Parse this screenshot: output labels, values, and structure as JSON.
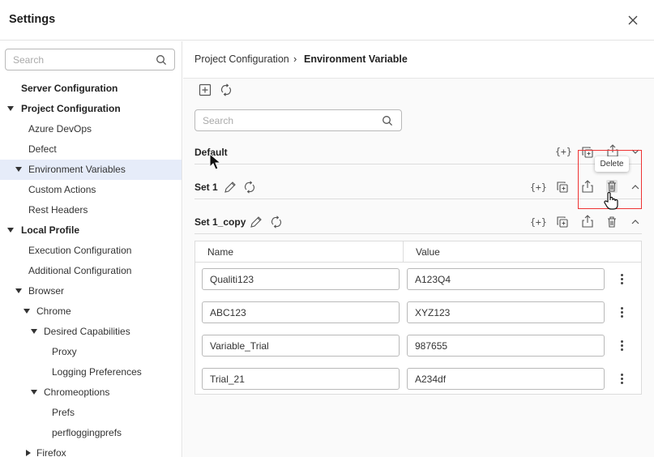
{
  "window": {
    "title": "Settings"
  },
  "sidebar": {
    "search_placeholder": "Search",
    "items": [
      {
        "label": "Server Configuration",
        "bold": true,
        "level": 0,
        "caret": "none"
      },
      {
        "label": "Project Configuration",
        "bold": true,
        "level": 0,
        "caret": "down"
      },
      {
        "label": "Azure DevOps",
        "bold": false,
        "level": 1,
        "caret": "none"
      },
      {
        "label": "Defect",
        "bold": false,
        "level": 1,
        "caret": "none"
      },
      {
        "label": "Environment Variables",
        "bold": false,
        "level": 1,
        "caret": "down",
        "selected": true
      },
      {
        "label": "Custom Actions",
        "bold": false,
        "level": 1,
        "caret": "none"
      },
      {
        "label": "Rest Headers",
        "bold": false,
        "level": 1,
        "caret": "none"
      },
      {
        "label": "Local Profile",
        "bold": true,
        "level": 0,
        "caret": "down"
      },
      {
        "label": "Execution Configuration",
        "bold": false,
        "level": 1,
        "caret": "none"
      },
      {
        "label": "Additional Configuration",
        "bold": false,
        "level": 1,
        "caret": "none"
      },
      {
        "label": "Browser",
        "bold": false,
        "level": 1,
        "caret": "down"
      },
      {
        "label": "Chrome",
        "bold": false,
        "level": 2,
        "caret": "down"
      },
      {
        "label": "Desired Capabilities",
        "bold": false,
        "level": 3,
        "caret": "down"
      },
      {
        "label": "Proxy",
        "bold": false,
        "level": 4,
        "caret": "none"
      },
      {
        "label": "Logging Preferences",
        "bold": false,
        "level": 4,
        "caret": "none"
      },
      {
        "label": "Chromeoptions",
        "bold": false,
        "level": 3,
        "caret": "down"
      },
      {
        "label": "Prefs",
        "bold": false,
        "level": 4,
        "caret": "none"
      },
      {
        "label": "perfloggingprefs",
        "bold": false,
        "level": 4,
        "caret": "none"
      },
      {
        "label": "Firefox",
        "bold": false,
        "level": 2,
        "caret": "right"
      }
    ]
  },
  "breadcrumb": {
    "parent": "Project Configuration",
    "separator": "›",
    "current": "Environment Variable"
  },
  "main": {
    "search_placeholder": "Search",
    "tooltip": "Delete",
    "icon_labels": {
      "variable": "{+}"
    },
    "sets": [
      {
        "name": "Default"
      },
      {
        "name": "Set 1"
      },
      {
        "name": "Set 1_copy"
      }
    ],
    "table": {
      "headers": [
        "Name",
        "Value"
      ],
      "rows": [
        {
          "name": "Qualiti123",
          "value": "A123Q4"
        },
        {
          "name": "ABC123",
          "value": "XYZ123"
        },
        {
          "name": "Variable_Trial",
          "value": "987655"
        },
        {
          "name": "Trial_21",
          "value": "A234df"
        }
      ]
    }
  },
  "colors": {
    "selected_bg": "#e6ecf9",
    "highlight_border": "#e33333",
    "border": "#dcdcdc"
  }
}
